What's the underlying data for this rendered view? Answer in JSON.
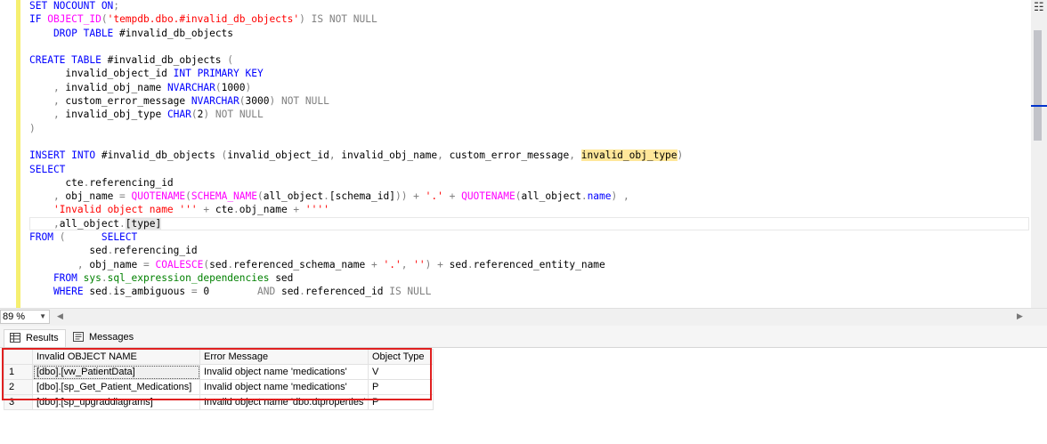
{
  "editor": {
    "lines": [
      [
        {
          "t": "SET NOCOUNT ON",
          "c": "kw"
        },
        {
          "t": ";",
          "c": "op"
        }
      ],
      [
        {
          "t": "IF ",
          "c": "kw"
        },
        {
          "t": "OBJECT_ID",
          "c": "fn"
        },
        {
          "t": "(",
          "c": "op"
        },
        {
          "t": "'tempdb.dbo.#invalid_db_objects'",
          "c": "str"
        },
        {
          "t": ") ",
          "c": "op"
        },
        {
          "t": "IS NOT NULL",
          "c": "op"
        }
      ],
      [
        {
          "t": "    DROP TABLE ",
          "c": "kw"
        },
        {
          "t": "#invalid_db_objects",
          "c": ""
        }
      ],
      [
        {
          "t": "",
          "c": ""
        }
      ],
      [
        {
          "t": "CREATE TABLE ",
          "c": "kw"
        },
        {
          "t": "#invalid_db_objects ",
          "c": ""
        },
        {
          "t": "(",
          "c": "op"
        }
      ],
      [
        {
          "t": "      invalid_object_id ",
          "c": ""
        },
        {
          "t": "INT PRIMARY KEY",
          "c": "kw"
        }
      ],
      [
        {
          "t": "    , ",
          "c": "op"
        },
        {
          "t": "invalid_obj_name ",
          "c": ""
        },
        {
          "t": "NVARCHAR",
          "c": "kw"
        },
        {
          "t": "(",
          "c": "op"
        },
        {
          "t": "1000",
          "c": ""
        },
        {
          "t": ")",
          "c": "op"
        }
      ],
      [
        {
          "t": "    , ",
          "c": "op"
        },
        {
          "t": "custom_error_message ",
          "c": ""
        },
        {
          "t": "NVARCHAR",
          "c": "kw"
        },
        {
          "t": "(",
          "c": "op"
        },
        {
          "t": "3000",
          "c": ""
        },
        {
          "t": ") ",
          "c": "op"
        },
        {
          "t": "NOT NULL",
          "c": "op"
        }
      ],
      [
        {
          "t": "    , ",
          "c": "op"
        },
        {
          "t": "invalid_obj_type ",
          "c": ""
        },
        {
          "t": "CHAR",
          "c": "kw"
        },
        {
          "t": "(",
          "c": "op"
        },
        {
          "t": "2",
          "c": ""
        },
        {
          "t": ") ",
          "c": "op"
        },
        {
          "t": "NOT NULL",
          "c": "op"
        }
      ],
      [
        {
          "t": ")",
          "c": "op"
        }
      ],
      [
        {
          "t": "",
          "c": ""
        }
      ],
      [
        {
          "t": "INSERT INTO ",
          "c": "kw"
        },
        {
          "t": "#invalid_db_objects ",
          "c": ""
        },
        {
          "t": "(",
          "c": "op"
        },
        {
          "t": "invalid_object_id",
          "c": ""
        },
        {
          "t": ", ",
          "c": "op"
        },
        {
          "t": "invalid_obj_name",
          "c": ""
        },
        {
          "t": ", ",
          "c": "op"
        },
        {
          "t": "custom_error_message",
          "c": ""
        },
        {
          "t": ", ",
          "c": "op"
        },
        {
          "t": "invalid_obj_type",
          "c": "hl"
        },
        {
          "t": ")",
          "c": "op"
        }
      ],
      [
        {
          "t": "SELECT",
          "c": "kw"
        }
      ],
      [
        {
          "t": "      cte",
          "c": ""
        },
        {
          "t": ".",
          "c": "op"
        },
        {
          "t": "referencing_id",
          "c": ""
        }
      ],
      [
        {
          "t": "    , ",
          "c": "op"
        },
        {
          "t": "obj_name ",
          "c": ""
        },
        {
          "t": "= ",
          "c": "op"
        },
        {
          "t": "QUOTENAME",
          "c": "fn"
        },
        {
          "t": "(",
          "c": "op"
        },
        {
          "t": "SCHEMA_NAME",
          "c": "fn"
        },
        {
          "t": "(",
          "c": "op"
        },
        {
          "t": "all_object",
          "c": ""
        },
        {
          "t": ".",
          "c": "op"
        },
        {
          "t": "[schema_id]",
          "c": ""
        },
        {
          "t": ")) + ",
          "c": "op"
        },
        {
          "t": "'.'",
          "c": "str"
        },
        {
          "t": " + ",
          "c": "op"
        },
        {
          "t": "QUOTENAME",
          "c": "fn"
        },
        {
          "t": "(",
          "c": "op"
        },
        {
          "t": "all_object",
          "c": ""
        },
        {
          "t": ".",
          "c": "op"
        },
        {
          "t": "name",
          "c": "kw"
        },
        {
          "t": ") ,",
          "c": "op"
        }
      ],
      [
        {
          "t": "    ",
          "c": ""
        },
        {
          "t": "'Invalid object name ''' ",
          "c": "str"
        },
        {
          "t": "+ ",
          "c": "op"
        },
        {
          "t": "cte",
          "c": ""
        },
        {
          "t": ".",
          "c": "op"
        },
        {
          "t": "obj_name ",
          "c": ""
        },
        {
          "t": "+ ",
          "c": "op"
        },
        {
          "t": "''''",
          "c": "str"
        }
      ],
      [
        {
          "t": "    ,",
          "c": "op"
        },
        {
          "t": "all_object",
          "c": ""
        },
        {
          "t": ".",
          "c": "op"
        },
        {
          "t": "[type]",
          "c": "hl2"
        }
      ],
      [
        {
          "t": "FROM ",
          "c": "kw"
        },
        {
          "t": "(      ",
          "c": "op"
        },
        {
          "t": "SELECT",
          "c": "kw"
        }
      ],
      [
        {
          "t": "          sed",
          "c": ""
        },
        {
          "t": ".",
          "c": "op"
        },
        {
          "t": "referencing_id",
          "c": ""
        }
      ],
      [
        {
          "t": "        , ",
          "c": "op"
        },
        {
          "t": "obj_name ",
          "c": ""
        },
        {
          "t": "= ",
          "c": "op"
        },
        {
          "t": "COALESCE",
          "c": "fn"
        },
        {
          "t": "(",
          "c": "op"
        },
        {
          "t": "sed",
          "c": ""
        },
        {
          "t": ".",
          "c": "op"
        },
        {
          "t": "referenced_schema_name ",
          "c": ""
        },
        {
          "t": "+ ",
          "c": "op"
        },
        {
          "t": "'.'",
          "c": "str"
        },
        {
          "t": ", ",
          "c": "op"
        },
        {
          "t": "''",
          "c": "str"
        },
        {
          "t": ") + ",
          "c": "op"
        },
        {
          "t": "sed",
          "c": ""
        },
        {
          "t": ".",
          "c": "op"
        },
        {
          "t": "referenced_entity_name",
          "c": ""
        }
      ],
      [
        {
          "t": "    FROM ",
          "c": "kw"
        },
        {
          "t": "sys",
          "c": "sys"
        },
        {
          "t": ".",
          "c": "op"
        },
        {
          "t": "sql_expression_dependencies ",
          "c": "sys"
        },
        {
          "t": "sed",
          "c": ""
        }
      ],
      [
        {
          "t": "    WHERE ",
          "c": "kw"
        },
        {
          "t": "sed",
          "c": ""
        },
        {
          "t": ".",
          "c": "op"
        },
        {
          "t": "is_ambiguous ",
          "c": ""
        },
        {
          "t": "= ",
          "c": "op"
        },
        {
          "t": "0        ",
          "c": ""
        },
        {
          "t": "AND ",
          "c": "op"
        },
        {
          "t": "sed",
          "c": ""
        },
        {
          "t": ".",
          "c": "op"
        },
        {
          "t": "referenced_id ",
          "c": ""
        },
        {
          "t": "IS NULL",
          "c": "op"
        }
      ]
    ],
    "current_line": 16
  },
  "zoom": {
    "value": "89 %"
  },
  "tabs": {
    "results_label": "Results",
    "messages_label": "Messages"
  },
  "grid": {
    "columns": [
      "Invalid OBJECT NAME",
      "Error Message",
      "Object Type"
    ],
    "rows": [
      {
        "num": "1",
        "name": "[dbo].[vw_PatientData]",
        "error": "Invalid object name 'medications'",
        "type": "V"
      },
      {
        "num": "2",
        "name": "[dbo].[sp_Get_Patient_Medications]",
        "error": "Invalid object name 'medications'",
        "type": "P"
      },
      {
        "num": "3",
        "name": "[dbo].[sp_upgraddiagrams]",
        "error": "Invalid object name 'dbo.dtproperties'",
        "type": "P"
      }
    ]
  },
  "colors": {
    "highlight_box": "#e02020",
    "editor_margin": "#f6ef70",
    "keyword": "#0000ff",
    "function": "#ff00ff",
    "string": "#ff0000",
    "system": "#008000"
  }
}
